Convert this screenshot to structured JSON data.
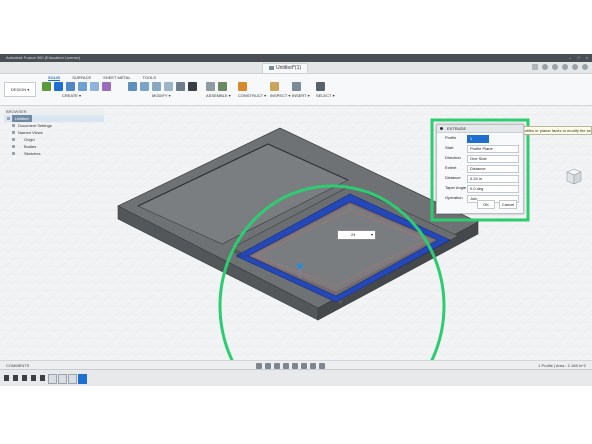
{
  "window": {
    "title": "Autodesk Fusion 360 (Education License)",
    "document_tab": "Untitled*(1)"
  },
  "toolbar": {
    "workspace": "DESIGN ▾",
    "tabs": [
      "SOLID",
      "SURFACE",
      "SHEET METAL",
      "TOOLS"
    ],
    "groups": [
      "CREATE ▾",
      "MODIFY ▾",
      "ASSEMBLE ▾",
      "CONSTRUCT ▾",
      "INSPECT ▾",
      "INSERT ▾",
      "SELECT ▾"
    ]
  },
  "browser": {
    "header": "BROWSER",
    "root": "Untitled",
    "items": [
      "Document Settings",
      "Named Views",
      "Origin",
      "Bodies",
      "Sketches"
    ]
  },
  "extrude": {
    "title": "EXTRUDE",
    "tooltip": "Specify distance, or select coplanar profiles or planar faces to modify the selection",
    "fields": [
      {
        "label": "Profile",
        "value": "1 selected"
      },
      {
        "label": "Start",
        "value": "Profile Plane"
      },
      {
        "label": "Direction",
        "value": "One Side"
      },
      {
        "label": "Extent",
        "value": "Distance"
      },
      {
        "label": "Distance",
        "value": "0.24 in"
      },
      {
        "label": "Taper Angle",
        "value": "0.0 deg"
      },
      {
        "label": "Operation",
        "value": "Join"
      }
    ],
    "ok": "OK",
    "cancel": "Cancel"
  },
  "distance_input": {
    "value": "24"
  },
  "status": {
    "comments": "COMMENTS",
    "info": "1 Profile | Area : 2.168 in^2"
  },
  "colors": {
    "accent": "#1f6fd1",
    "highlight": "#2ecc71",
    "body_top": "#6e7274",
    "body_side": "#4f5355",
    "profile": "#2448b8"
  },
  "icons": [
    "sketch-icon",
    "box-icon",
    "extrude-icon",
    "fillet-icon",
    "move-icon",
    "orbit-icon",
    "pan-icon",
    "zoom-icon",
    "grid-icon",
    "play-icon",
    "rewind-icon",
    "step-back-icon",
    "step-forward-icon",
    "end-icon"
  ]
}
